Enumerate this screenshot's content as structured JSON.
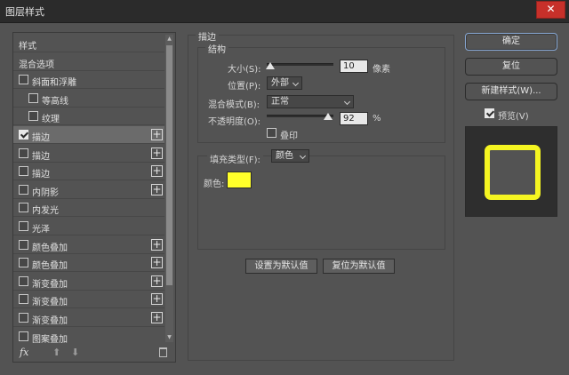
{
  "window": {
    "title": "图层样式",
    "close_label": "✕"
  },
  "left_panel": {
    "items": [
      {
        "label": "样式",
        "checkbox": false,
        "checked": false,
        "plus": false,
        "indent": 0,
        "selected": false
      },
      {
        "label": "混合选项",
        "checkbox": false,
        "checked": false,
        "plus": false,
        "indent": 0,
        "selected": false
      },
      {
        "label": "斜面和浮雕",
        "checkbox": true,
        "checked": false,
        "plus": false,
        "indent": 0,
        "selected": false
      },
      {
        "label": "等高线",
        "checkbox": true,
        "checked": false,
        "plus": false,
        "indent": 1,
        "selected": false
      },
      {
        "label": "纹理",
        "checkbox": true,
        "checked": false,
        "plus": false,
        "indent": 1,
        "selected": false
      },
      {
        "label": "描边",
        "checkbox": true,
        "checked": true,
        "plus": true,
        "indent": 0,
        "selected": true
      },
      {
        "label": "描边",
        "checkbox": true,
        "checked": false,
        "plus": true,
        "indent": 0,
        "selected": false
      },
      {
        "label": "描边",
        "checkbox": true,
        "checked": false,
        "plus": true,
        "indent": 0,
        "selected": false
      },
      {
        "label": "内阴影",
        "checkbox": true,
        "checked": false,
        "plus": true,
        "indent": 0,
        "selected": false
      },
      {
        "label": "内发光",
        "checkbox": true,
        "checked": false,
        "plus": false,
        "indent": 0,
        "selected": false
      },
      {
        "label": "光泽",
        "checkbox": true,
        "checked": false,
        "plus": false,
        "indent": 0,
        "selected": false
      },
      {
        "label": "颜色叠加",
        "checkbox": true,
        "checked": false,
        "plus": true,
        "indent": 0,
        "selected": false
      },
      {
        "label": "颜色叠加",
        "checkbox": true,
        "checked": false,
        "plus": true,
        "indent": 0,
        "selected": false
      },
      {
        "label": "渐变叠加",
        "checkbox": true,
        "checked": false,
        "plus": true,
        "indent": 0,
        "selected": false
      },
      {
        "label": "渐变叠加",
        "checkbox": true,
        "checked": false,
        "plus": true,
        "indent": 0,
        "selected": false
      },
      {
        "label": "渐变叠加",
        "checkbox": true,
        "checked": false,
        "plus": true,
        "indent": 0,
        "selected": false
      },
      {
        "label": "图案叠加",
        "checkbox": true,
        "checked": false,
        "plus": false,
        "indent": 0,
        "selected": false
      }
    ],
    "footer": {
      "fx_label": "fx",
      "up_glyph": "⬆",
      "down_glyph": "⬇"
    }
  },
  "stroke": {
    "section_title": "描边",
    "structure": {
      "title": "结构",
      "size_label": "大小(S):",
      "size_value": "10",
      "size_unit": "像素",
      "size_slider_fraction": 0.05,
      "position_label": "位置(P):",
      "position_value": "外部",
      "blend_label": "混合模式(B):",
      "blend_value": "正常",
      "opacity_label": "不透明度(O):",
      "opacity_value": "92",
      "opacity_unit": "%",
      "opacity_slider_fraction": 0.92,
      "emboss_label": "叠印",
      "emboss_checked": false
    },
    "fill": {
      "type_label": "填充类型(F):",
      "type_value": "颜色",
      "color_label": "颜色:",
      "color": "#ffff2a"
    },
    "set_default_label": "设置为默认值",
    "reset_default_label": "复位为默认值"
  },
  "right_panel": {
    "ok_label": "确定",
    "reset_label": "复位",
    "new_style_label": "新建样式(W)...",
    "preview_label": "预览(V)",
    "preview_checked": true,
    "preview_stroke_color": "#f5f521"
  }
}
